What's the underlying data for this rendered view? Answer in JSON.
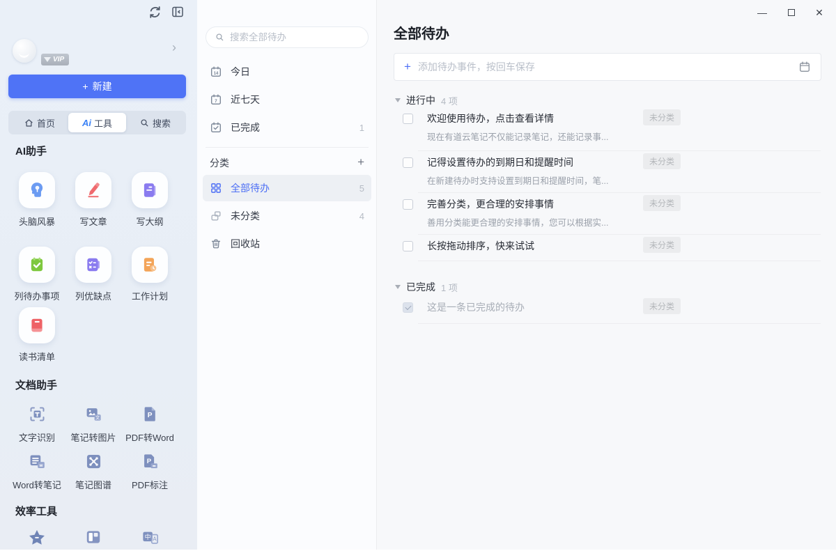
{
  "colors": {
    "accent": "#4c6ef5",
    "new_button": "#4f73f6",
    "selected_bg": "#edf0f4"
  },
  "window": {
    "minimize": "—",
    "close": "✕"
  },
  "sidebar": {
    "vip": "VIP",
    "chevron": "›",
    "new_button": {
      "plus": "+",
      "label": "新建"
    },
    "tabs": {
      "home": "首页",
      "ai_prefix": "Ai",
      "ai": "工具",
      "search": "搜索"
    },
    "sections": {
      "ai": "AI助手",
      "doc": "文档助手",
      "eff": "效率工具"
    },
    "ai_tools": [
      {
        "label": "头脑风暴"
      },
      {
        "label": "写文章"
      },
      {
        "label": "写大纲"
      },
      {
        "label": "列待办事项"
      },
      {
        "label": "列优缺点"
      },
      {
        "label": "工作计划"
      },
      {
        "label": "读书清单"
      }
    ],
    "doc_tools": [
      {
        "label": "文字识别"
      },
      {
        "label": "笔记转图片"
      },
      {
        "label": "PDF转Word"
      },
      {
        "label": "Word转笔记"
      },
      {
        "label": "笔记图谱"
      },
      {
        "label": "PDF标注"
      }
    ]
  },
  "midpanel": {
    "search_placeholder": "搜索全部待办",
    "icons": {
      "today_num": "14",
      "week_num": "7"
    },
    "smart_lists": [
      {
        "label": "今日",
        "count": ""
      },
      {
        "label": "近七天",
        "count": ""
      },
      {
        "label": "已完成",
        "count": "1"
      }
    ],
    "category_header": "分类",
    "add_plus": "+",
    "categories": [
      {
        "label": "全部待办",
        "count": "5"
      },
      {
        "label": "未分类",
        "count": "4"
      },
      {
        "label": "回收站",
        "count": ""
      }
    ]
  },
  "main": {
    "title": "全部待办",
    "add_plus": "+",
    "add_placeholder": "添加待办事件，按回车保存",
    "sections": [
      {
        "name": "进行中",
        "count": "4 项"
      },
      {
        "name": "已完成",
        "count": "1 项"
      }
    ],
    "todos_active": [
      {
        "title": "欢迎使用待办，点击查看详情",
        "subtitle": "现在有道云笔记不仅能记录笔记，还能记录事...",
        "tag": "未分类"
      },
      {
        "title": "记得设置待办的到期日和提醒时间",
        "subtitle": "在新建待办时支持设置到期日和提醒时间，笔...",
        "tag": "未分类"
      },
      {
        "title": "完善分类，更合理的安排事情",
        "subtitle": "善用分类能更合理的安排事情，您可以根据实...",
        "tag": "未分类"
      },
      {
        "title": "长按拖动排序，快来试试",
        "subtitle": "",
        "tag": "未分类"
      }
    ],
    "todos_done": [
      {
        "title": "这是一条已完成的待办",
        "tag": "未分类"
      }
    ]
  }
}
